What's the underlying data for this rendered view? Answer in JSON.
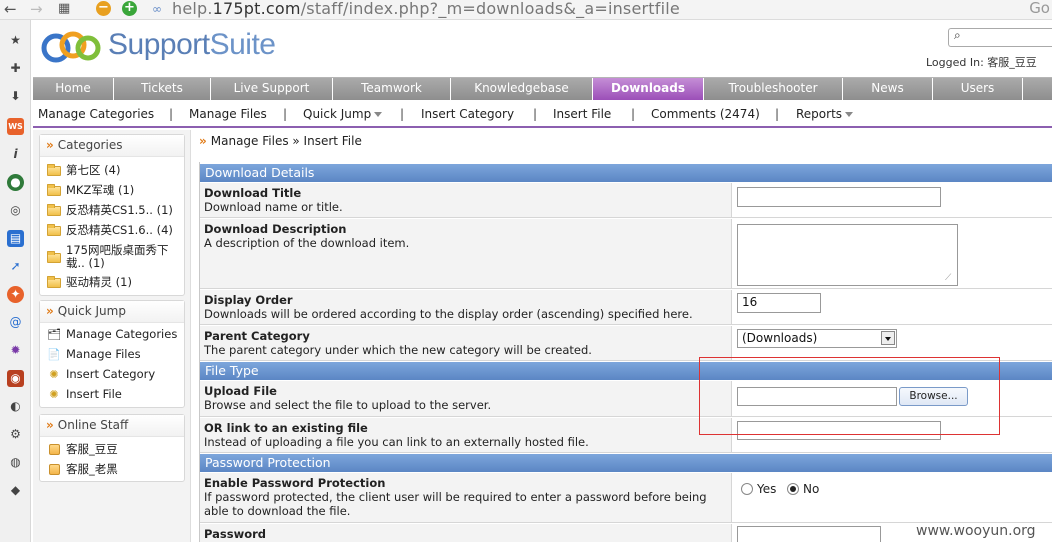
{
  "browser": {
    "back_glyph": "←",
    "forward_glyph": "→",
    "url_prefix": "help.",
    "url_domain": "175pt.com",
    "url_path": "/staff/index.php?_m=downloads&_a=insertfile",
    "go_label": "Go"
  },
  "header": {
    "logo_support": "Support",
    "logo_suite": "Suite",
    "search_glyph": "⌕",
    "logged_in": "Logged In: 客服_豆豆"
  },
  "main_nav": {
    "tabs": [
      {
        "label": "Home"
      },
      {
        "label": "Tickets"
      },
      {
        "label": "Live Support"
      },
      {
        "label": "Teamwork"
      },
      {
        "label": "Knowledgebase"
      },
      {
        "label": "Downloads"
      },
      {
        "label": "Troubleshooter"
      },
      {
        "label": "News"
      },
      {
        "label": "Users"
      }
    ],
    "active_tab": "Downloads",
    "active_color": "#a45fbf"
  },
  "sub_nav": {
    "manage_categories": "Manage Categories",
    "manage_files": "Manage Files",
    "quick_jump": "Quick Jump",
    "insert_category": "Insert Category",
    "insert_file": "Insert File",
    "comments": "Comments (2474)",
    "reports": "Reports",
    "separator": "|"
  },
  "sidebar": {
    "categories_title": "Categories",
    "categories": [
      {
        "label": "第七区 (4)"
      },
      {
        "label": "MKZ军魂 (1)"
      },
      {
        "label": "反恐精英CS1.5.. (1)"
      },
      {
        "label": "反恐精英CS1.6.. (4)"
      },
      {
        "label": "175网吧版桌面秀下载.. (1)"
      },
      {
        "label": "驱动精灵 (1)"
      }
    ],
    "quick_jump_title": "Quick Jump",
    "quick_jump": [
      {
        "label": "Manage Categories"
      },
      {
        "label": "Manage Files"
      },
      {
        "label": "Insert Category"
      },
      {
        "label": "Insert File"
      }
    ],
    "online_staff_title": "Online Staff",
    "online_staff": [
      {
        "label": "客服_豆豆"
      },
      {
        "label": "客服_老黑"
      }
    ],
    "arrow_glyph": "»"
  },
  "breadcrumb": {
    "arrow": "»",
    "text": "Manage Files » Insert File"
  },
  "form": {
    "download_details": {
      "heading": "Download Details",
      "title_label": "Download Title",
      "title_desc": "Download name or title.",
      "title_value": "",
      "desc_label": "Download Description",
      "desc_desc": "A description of the download item.",
      "desc_value": "",
      "order_label": "Display Order",
      "order_desc": "Downloads will be ordered according to the display order (ascending) specified here.",
      "order_value": "16",
      "parent_label": "Parent Category",
      "parent_desc": "The parent category under which the new category will be created.",
      "parent_value": "(Downloads)"
    },
    "file_type": {
      "heading": "File Type",
      "upload_label": "Upload File",
      "upload_desc": "Browse and select the file to upload to the server.",
      "browse_label": "Browse...",
      "link_label": "OR link to an existing file",
      "link_desc": "Instead of uploading a file you can link to an externally hosted file.",
      "link_value": ""
    },
    "password_protection": {
      "heading": "Password Protection",
      "enable_label": "Enable Password Protection",
      "enable_desc": "If password protected, the client user will be required to enter a password before being able to download the file.",
      "yes_label": "Yes",
      "no_label": "No",
      "selected": "No",
      "password_label": "Password"
    }
  },
  "watermark": "www.wooyun.org",
  "colors": {
    "section_blue": "#6b95d0",
    "nav_gray": "#9a9a9a",
    "accent_orange": "#e07b18",
    "highlight_red": "#d33333"
  }
}
